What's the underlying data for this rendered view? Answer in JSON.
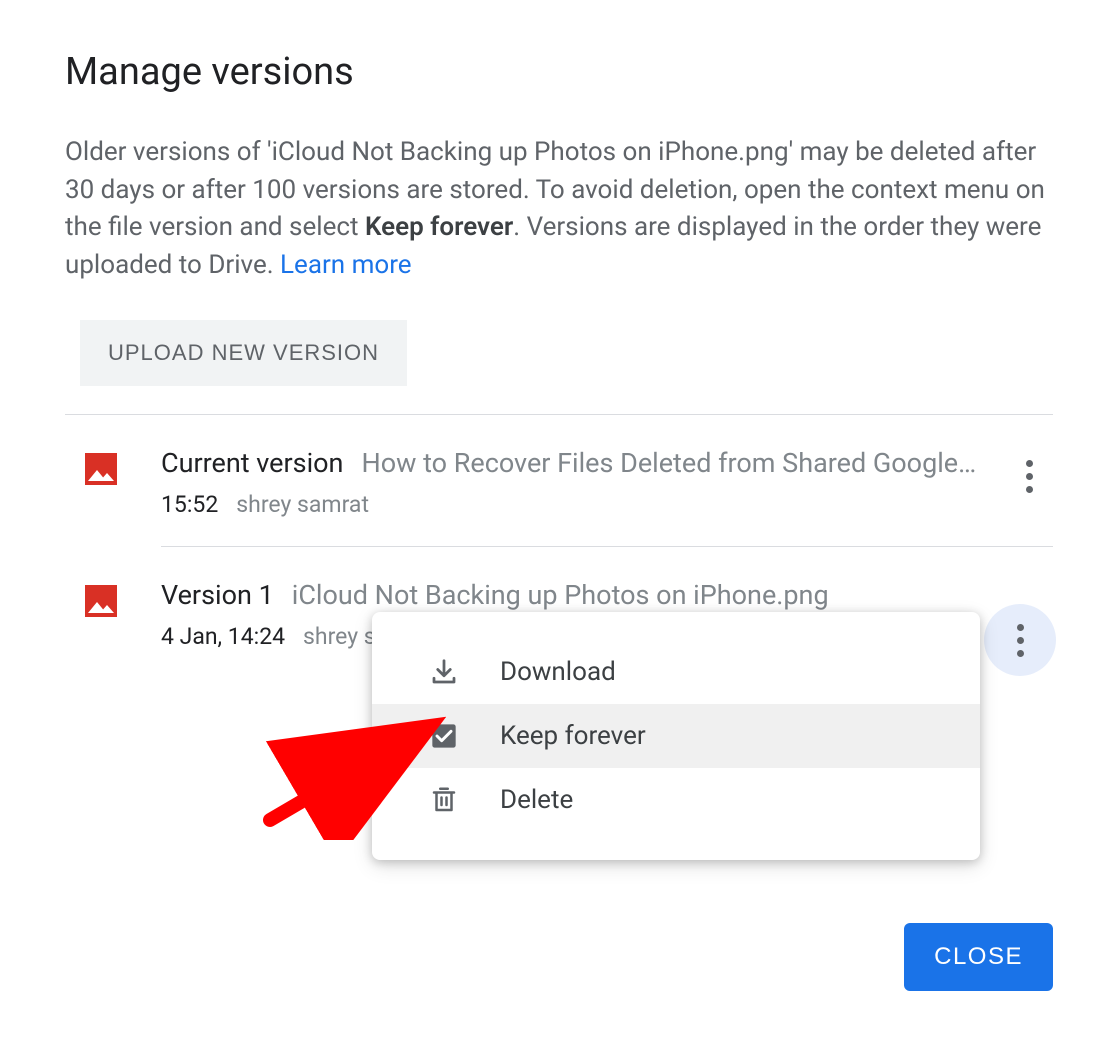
{
  "dialog": {
    "title": "Manage versions",
    "description_part1": "Older versions of 'iCloud Not Backing up Photos on iPhone.png' may be deleted after 30 days or after 100 versions are stored. To avoid deletion, open the context menu on the file version and select ",
    "description_bold": "Keep forever",
    "description_part2": ". Versions are displayed in the order they were uploaded to Drive. ",
    "learn_more": "Learn more",
    "upload_button": "UPLOAD NEW VERSION",
    "close_button": "CLOSE"
  },
  "versions": [
    {
      "label": "Current version",
      "filename": "How to Recover Files Deleted from Shared Google…",
      "time": "15:52",
      "author": "shrey samrat"
    },
    {
      "label": "Version 1",
      "filename": "iCloud Not Backing up Photos on iPhone.png",
      "time": "4 Jan, 14:24",
      "author": "shrey samrat"
    }
  ],
  "context_menu": {
    "download": "Download",
    "keep_forever": "Keep forever",
    "delete": "Delete"
  }
}
